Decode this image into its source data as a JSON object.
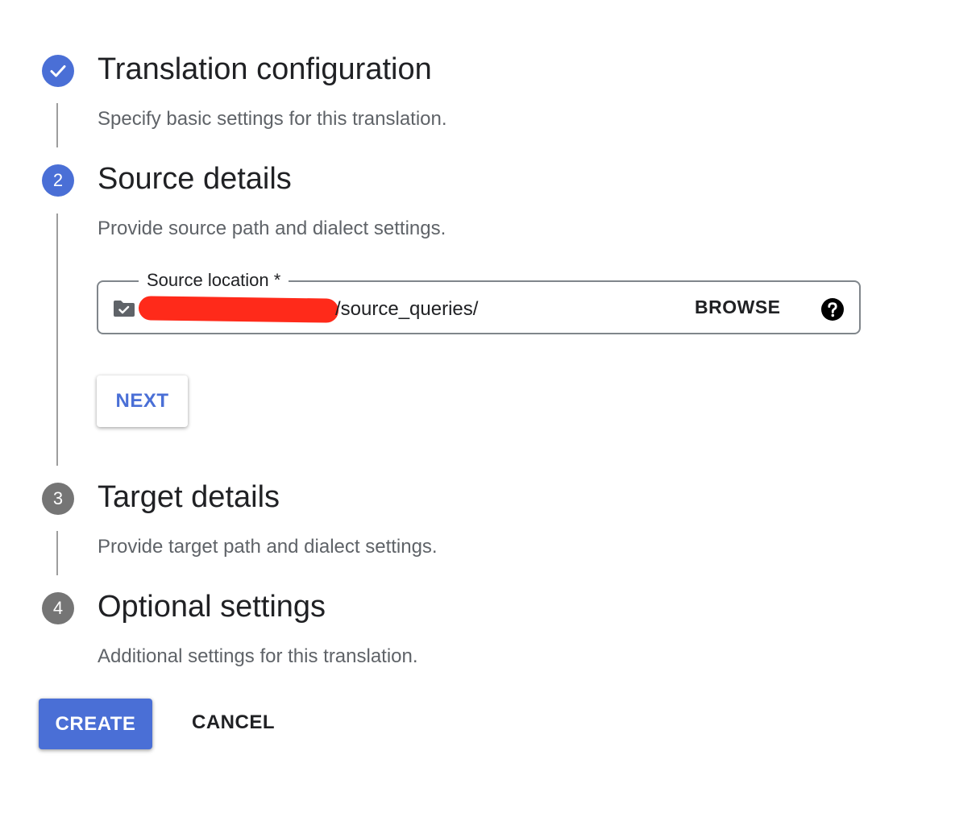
{
  "steps": [
    {
      "number": "",
      "status": "done",
      "icon": "check-icon",
      "title": "Translation configuration",
      "description": "Specify basic settings for this translation."
    },
    {
      "number": "2",
      "status": "active",
      "title": "Source details",
      "description": "Provide source path and dialect settings."
    },
    {
      "number": "3",
      "status": "pending",
      "title": "Target details",
      "description": "Provide target path and dialect settings."
    },
    {
      "number": "4",
      "status": "pending",
      "title": "Optional settings",
      "description": "Additional settings for this translation."
    }
  ],
  "source_field": {
    "label": "Source location *",
    "value_suffix": "/source_queries/",
    "folder_icon": "folder-check-icon",
    "browse_label": "BROWSE",
    "help_icon": "help-circle-icon"
  },
  "next_label": "NEXT",
  "actions": {
    "create_label": "CREATE",
    "cancel_label": "CANCEL"
  },
  "colors": {
    "accent": "#4a6fd6",
    "pending": "#757575",
    "redaction": "#ff2a1a"
  }
}
